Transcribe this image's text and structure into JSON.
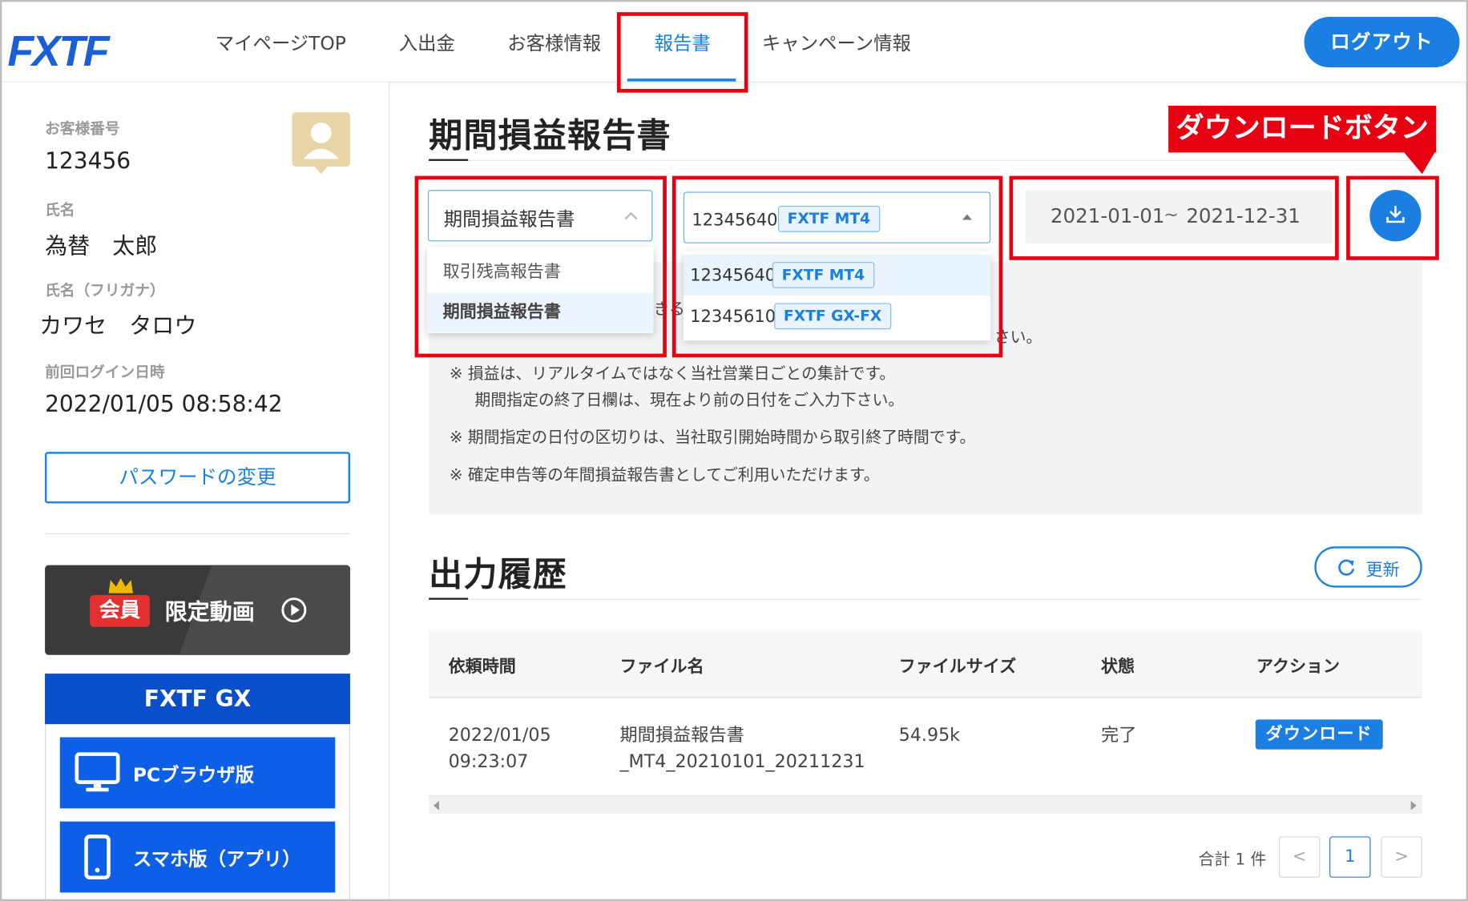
{
  "header": {
    "logo_text": "FXTF",
    "nav": [
      {
        "label": "マイページTOP"
      },
      {
        "label": "入出金"
      },
      {
        "label": "お客様情報"
      },
      {
        "label": "報告書"
      },
      {
        "label": "キャンペーン情報"
      }
    ],
    "active_nav": "報告書",
    "logout_label": "ログアウト"
  },
  "sidebar": {
    "customer_number_label": "お客様番号",
    "customer_number": "123456",
    "name_label": "氏名",
    "name": "為替　太郎",
    "kana_label": "氏名（フリガナ）",
    "kana": "カワセ　タロウ",
    "last_login_label": "前回ログイン日時",
    "last_login": "2022/01/05 08:58:42",
    "password_button": "パスワードの変更",
    "members_badge": "会員",
    "members_label": "限定動画",
    "gx_title": "FXTF GX",
    "gx_pc": "PCブラウザ版",
    "gx_phone": "スマホ版（アプリ）"
  },
  "report": {
    "title": "期間損益報告書",
    "report_type_selected": "期間損益報告書",
    "report_type_options": [
      "取引残高報告書",
      "期間損益報告書"
    ],
    "account_selected": {
      "number": "12345640",
      "tag": "FXTF MT4"
    },
    "account_options": [
      {
        "number": "12345640",
        "tag": "FXTF MT4"
      },
      {
        "number": "12345610",
        "tag": "FXTF GX-FX"
      }
    ],
    "date_start": "2021-01-01",
    "date_sep": "~",
    "date_end": "2021-12-31",
    "callout": "ダウンロードボタン",
    "notes": [
      "※ 損益は、リアルタイムではなく当社営業日ごとの集計です。",
      "期間指定の終了日欄は、現在より前の日付をご入力下さい。",
      "※ 期間指定の日付の区切りは、当社取引開始時間から取引終了時間です。",
      "※ 確定申告等の年間損益報告書としてご利用いただけます。"
    ],
    "partial_note_fragment_1": "きる",
    "partial_note_fragment_2": "さい。"
  },
  "history": {
    "title": "出力履歴",
    "refresh_label": "更新",
    "columns": [
      "依頼時間",
      "ファイル名",
      "ファイルサイズ",
      "状態",
      "アクション"
    ],
    "rows": [
      {
        "time_line1": "2022/01/05",
        "time_line2": "09:23:07",
        "file_line1": "期間損益報告書",
        "file_line2": "_MT4_20210101_20211231",
        "size": "54.95k",
        "status": "完了",
        "action": "ダウンロード"
      }
    ],
    "total": "合計 1 件",
    "pagination": {
      "prev": "<",
      "current": "1",
      "next": ">"
    }
  },
  "colors": {
    "accent": "#1a7fe0",
    "annotation_red": "#e60012",
    "gx_navy": "#0a4fc9",
    "gx_blue": "#0d5fe8"
  }
}
